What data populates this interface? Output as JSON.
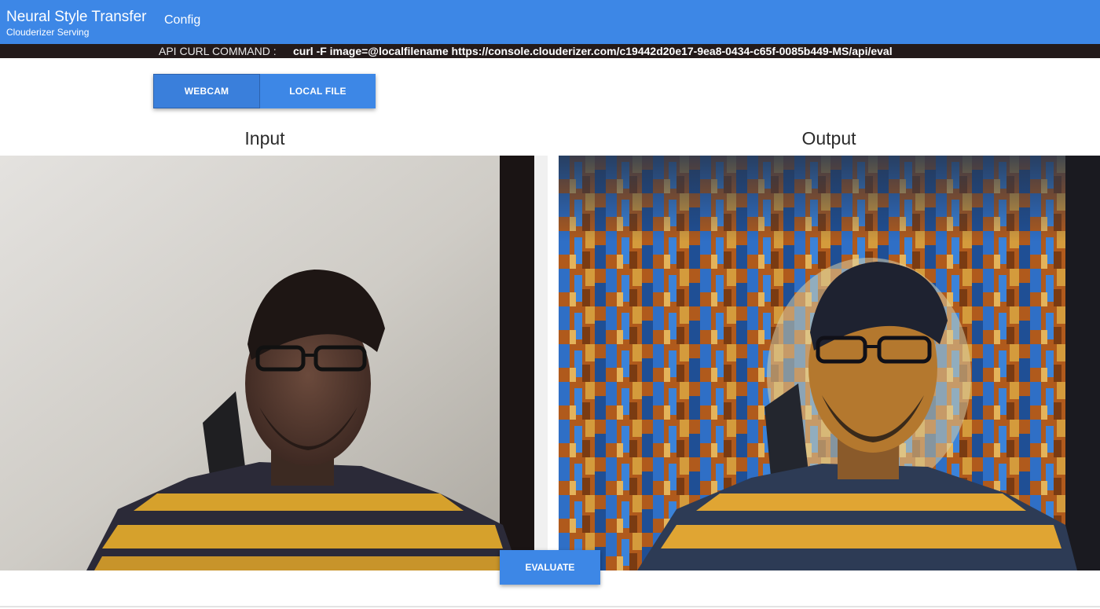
{
  "app": {
    "title": "Neural Style Transfer",
    "subtitle": "Clouderizer Serving",
    "config_label": "Config"
  },
  "api": {
    "label": "API CURL COMMAND :",
    "command": "curl -F image=@localfilename https://console.clouderizer.com/c19442d20e17-9ea8-0434-c65f-0085b449-MS/api/eval"
  },
  "tabs": [
    {
      "label": "WEBCAM",
      "active": true
    },
    {
      "label": "LOCAL FILE",
      "active": false
    }
  ],
  "panels": {
    "input_title": "Input",
    "output_title": "Output"
  },
  "actions": {
    "evaluate_label": "EVALUATE"
  },
  "colors": {
    "primary": "#3d87e6",
    "api_strip_bg": "#231a1a"
  }
}
